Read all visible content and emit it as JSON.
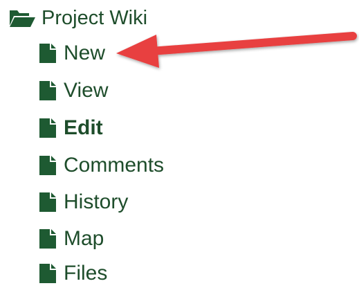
{
  "tree": {
    "root": {
      "label": "Project Wiki",
      "icon": "folder-open-icon"
    },
    "items": [
      {
        "label": "New",
        "icon": "document-icon",
        "bold": false
      },
      {
        "label": "View",
        "icon": "document-icon",
        "bold": false
      },
      {
        "label": "Edit",
        "icon": "document-icon",
        "bold": true
      },
      {
        "label": "Comments",
        "icon": "document-icon",
        "bold": false
      },
      {
        "label": "History",
        "icon": "document-icon",
        "bold": false
      },
      {
        "label": "Map",
        "icon": "document-icon",
        "bold": false
      },
      {
        "label": "Files",
        "icon": "document-icon",
        "bold": false
      }
    ]
  },
  "annotation": {
    "type": "arrow",
    "target": "New",
    "color": "#e8403f"
  },
  "colors": {
    "text": "#1e4d2b",
    "icon": "#1e5a32"
  }
}
